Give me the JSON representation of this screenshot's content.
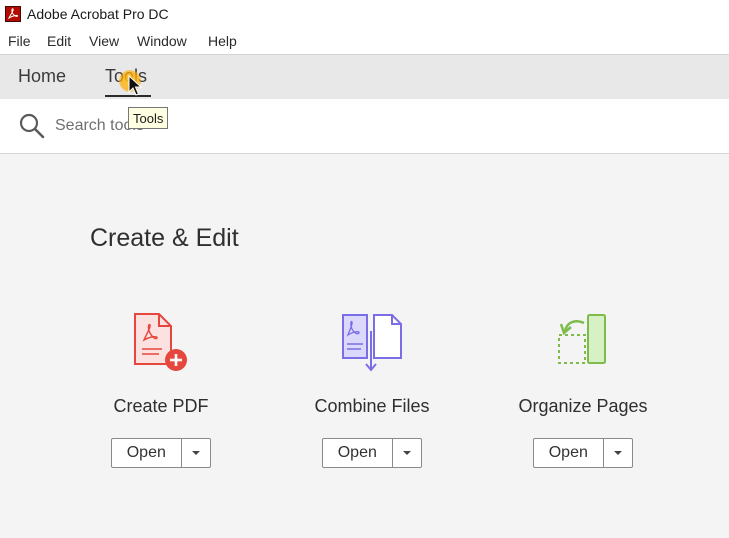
{
  "window": {
    "title": "Adobe Acrobat Pro DC",
    "app_icon": "acrobat-logo-icon"
  },
  "menu": [
    "File",
    "Edit",
    "View",
    "Window",
    "Help"
  ],
  "tabs": [
    {
      "label": "Home",
      "active": false
    },
    {
      "label": "Tools",
      "active": true
    }
  ],
  "search": {
    "placeholder": "Search tools",
    "icon": "search-icon"
  },
  "tooltip": {
    "text": "Tools"
  },
  "section": {
    "title": "Create & Edit"
  },
  "tools": [
    {
      "label": "Create PDF",
      "icon": "create-pdf-icon",
      "open_label": "Open",
      "accent": "#e5473e"
    },
    {
      "label": "Combine Files",
      "icon": "combine-files-icon",
      "open_label": "Open",
      "accent": "#7a6ee6"
    },
    {
      "label": "Organize Pages",
      "icon": "organize-pages-icon",
      "open_label": "Open",
      "accent": "#7dbb4a"
    }
  ]
}
